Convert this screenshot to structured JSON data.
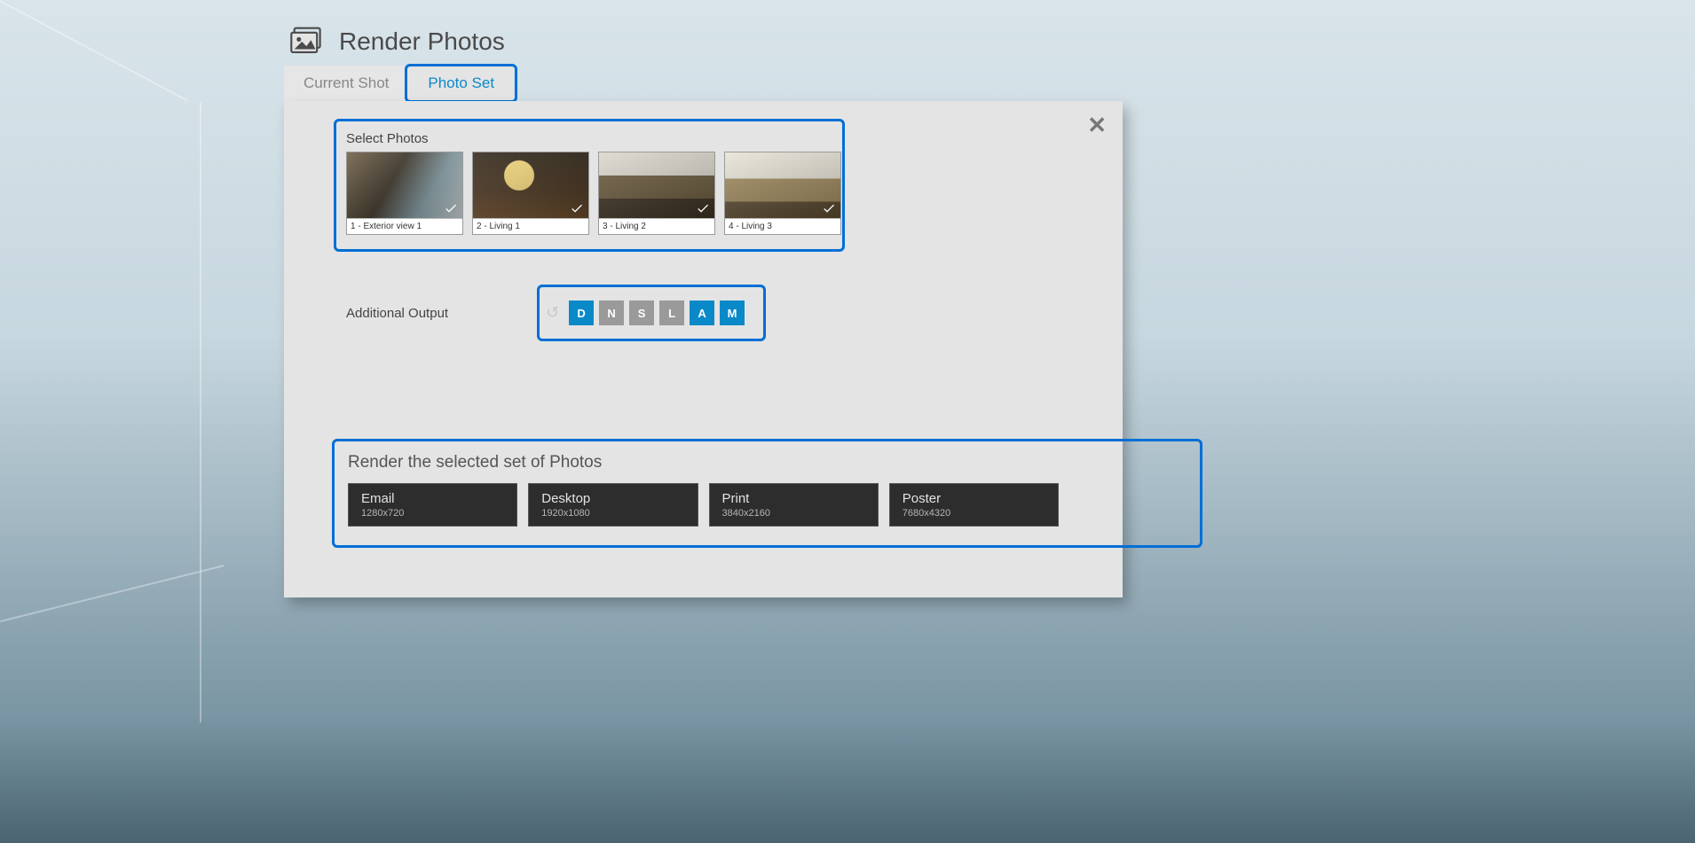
{
  "title": "Render Photos",
  "tabs": {
    "current_shot": "Current Shot",
    "photo_set": "Photo Set"
  },
  "close_label": "✕",
  "select_photos": {
    "label": "Select Photos",
    "items": [
      {
        "caption": "1 - Exterior view 1",
        "selected": true
      },
      {
        "caption": "2 - Living 1",
        "selected": true
      },
      {
        "caption": "3 - Living 2",
        "selected": true
      },
      {
        "caption": "4 - Living 3",
        "selected": true
      }
    ]
  },
  "additional_output": {
    "label": "Additional Output",
    "chips": [
      {
        "letter": "D",
        "on": true
      },
      {
        "letter": "N",
        "on": false
      },
      {
        "letter": "S",
        "on": false
      },
      {
        "letter": "L",
        "on": false
      },
      {
        "letter": "A",
        "on": true
      },
      {
        "letter": "M",
        "on": true
      }
    ]
  },
  "render": {
    "title": "Render the selected set of Photos",
    "buttons": [
      {
        "label": "Email",
        "resolution": "1280x720"
      },
      {
        "label": "Desktop",
        "resolution": "1920x1080"
      },
      {
        "label": "Print",
        "resolution": "3840x2160"
      },
      {
        "label": "Poster",
        "resolution": "7680x4320"
      }
    ]
  },
  "colors": {
    "highlight": "#006fd6",
    "accent": "#0a89c9"
  }
}
